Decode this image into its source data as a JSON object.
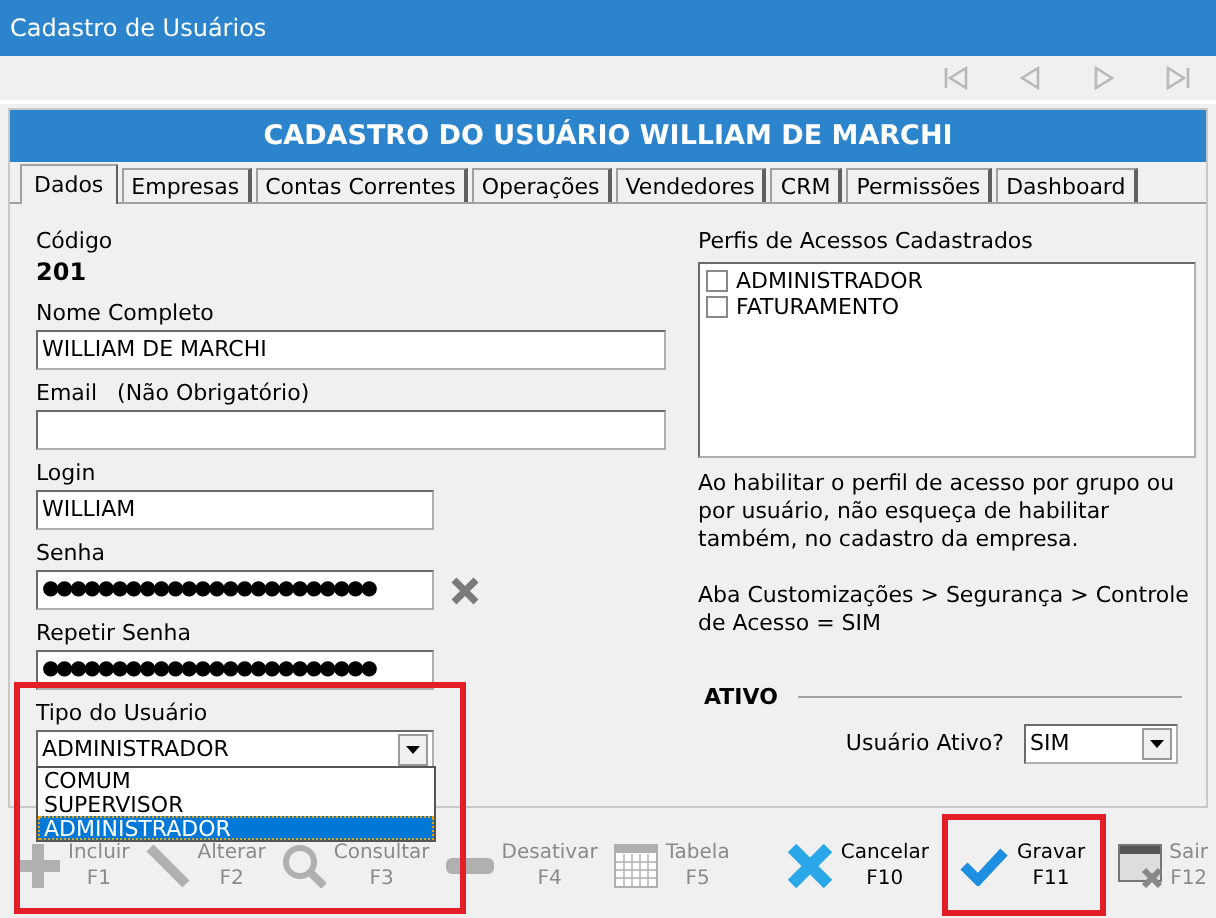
{
  "window": {
    "title": "Cadastro de Usuários"
  },
  "navigation": [
    {
      "kind": "first",
      "disabled": true
    },
    {
      "kind": "previous",
      "disabled": true
    },
    {
      "kind": "next",
      "disabled": true
    },
    {
      "kind": "last",
      "disabled": true
    }
  ],
  "heading": "CADASTRO DO USUÁRIO WILLIAM DE MARCHI",
  "tabs": [
    {
      "label": "Dados",
      "selected": true
    },
    {
      "label": "Empresas",
      "selected": false
    },
    {
      "label": "Contas Correntes",
      "selected": false
    },
    {
      "label": "Operações",
      "selected": false
    },
    {
      "label": "Vendedores",
      "selected": false
    },
    {
      "label": "CRM",
      "selected": false
    },
    {
      "label": "Permissões",
      "selected": false
    },
    {
      "label": "Dashboard",
      "selected": false
    }
  ],
  "code": {
    "label": "Código",
    "value": "201"
  },
  "fields": [
    {
      "kind": "wide",
      "label": "Nome Completo",
      "value": "WILLIAM DE MARCHI"
    },
    {
      "kind": "wide",
      "label": "Email",
      "note": "(Não Obrigatório)"
    },
    {
      "kind": "short",
      "label": "Login",
      "value": "WILLIAM"
    },
    {
      "kind": "password",
      "label": "Senha",
      "value": "●●●●●●●●●●●●●●●●●●●●●●●●"
    },
    {
      "kind": "short",
      "label": "Repetir Senha",
      "value": "●●●●●●●●●●●●●●●●●●●●●●●●"
    }
  ],
  "user_type": {
    "label": "Tipo do Usuário",
    "value": "ADMINISTRADOR",
    "expanded": true,
    "highlighted": true,
    "options": [
      {
        "label": "COMUM",
        "selected": false
      },
      {
        "label": "SUPERVISOR",
        "selected": false
      },
      {
        "label": "ADMINISTRADOR",
        "selected": true
      }
    ]
  },
  "profiles": {
    "label": "Perfis de Acessos Cadastrados",
    "items": [
      {
        "label": "ADMINISTRADOR",
        "checked": false
      },
      {
        "label": "FATURAMENTO",
        "checked": false
      }
    ]
  },
  "notes": [
    "Ao habilitar o perfil de acesso por grupo ou por usuário, não esqueça de habilitar também, no cadastro da empresa.",
    "Aba Customizações > Segurança > Controle de Acesso = SIM"
  ],
  "active": {
    "heading": "ATIVO",
    "label": "Usuário Ativo?",
    "value": "SIM"
  },
  "toolbar": [
    {
      "kind": "add",
      "label": "Incluir",
      "key": "F1",
      "disabled": true,
      "highlighted": false
    },
    {
      "kind": "edit",
      "label": "Alterar",
      "key": "F2",
      "disabled": true,
      "highlighted": false
    },
    {
      "kind": "search",
      "label": "Consultar",
      "key": "F3",
      "disabled": true,
      "highlighted": false
    },
    {
      "kind": "deactivate",
      "label": "Desativar",
      "key": "F4",
      "disabled": true,
      "highlighted": false
    },
    {
      "kind": "table",
      "label": "Tabela",
      "key": "F5",
      "disabled": true,
      "highlighted": false
    },
    {
      "kind": "cancel",
      "label": "Cancelar",
      "key": "F10",
      "disabled": false,
      "highlighted": false
    },
    {
      "kind": "save",
      "label": "Gravar",
      "key": "F11",
      "disabled": false,
      "highlighted": true
    },
    {
      "kind": "exit",
      "label": "Sair",
      "key": "F12",
      "disabled": true,
      "highlighted": false
    }
  ]
}
